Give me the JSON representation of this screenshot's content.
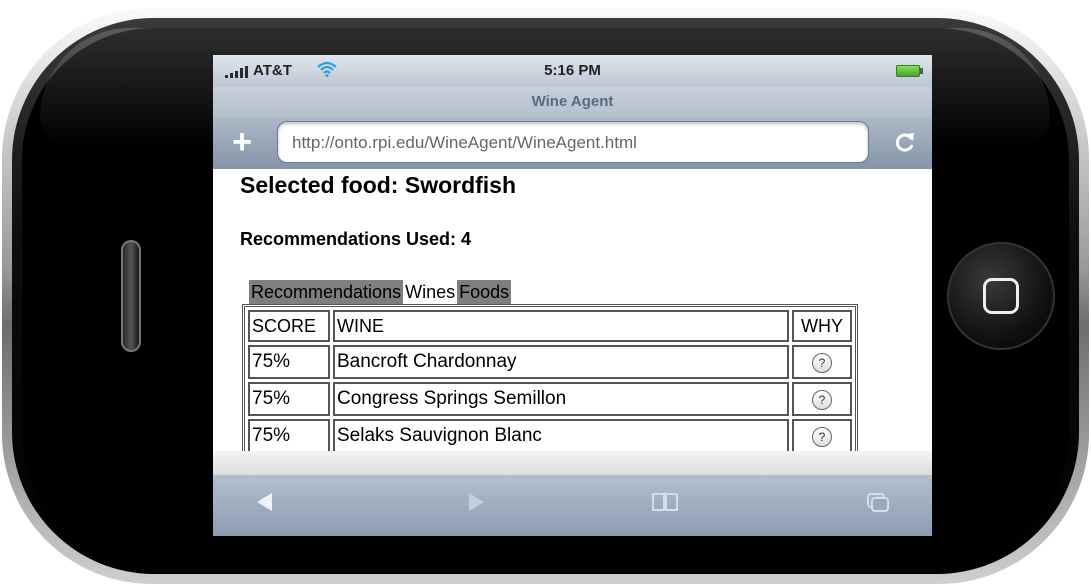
{
  "status_bar": {
    "carrier": "AT&T",
    "time": "5:16 PM",
    "battery_color": "#46a51f"
  },
  "browser": {
    "page_title": "Wine Agent",
    "url": "http://onto.rpi.edu/WineAgent/WineAgent.html",
    "add_icon": "plus-icon",
    "reload_icon": "reload-icon"
  },
  "page": {
    "selected_food": "Selected food: Swordfish",
    "recommendations_used": "Recommendations Used: 4",
    "tabs": [
      {
        "label": "Recommendations",
        "active": false
      },
      {
        "label": "Wines",
        "active": true
      },
      {
        "label": "Foods",
        "active": false
      }
    ],
    "table": {
      "headers": [
        "SCORE",
        "WINE",
        "WHY"
      ],
      "rows": [
        {
          "score": "75%",
          "wine": "Bancroft Chardonnay",
          "why": "?"
        },
        {
          "score": "75%",
          "wine": "Congress Springs Semillon",
          "why": "?"
        },
        {
          "score": "75%",
          "wine": "Selaks Sauvignon Blanc",
          "why": "?"
        }
      ]
    }
  },
  "toolbar": {
    "items": [
      "back-icon",
      "forward-icon",
      "bookmarks-icon",
      "pages-icon"
    ]
  }
}
